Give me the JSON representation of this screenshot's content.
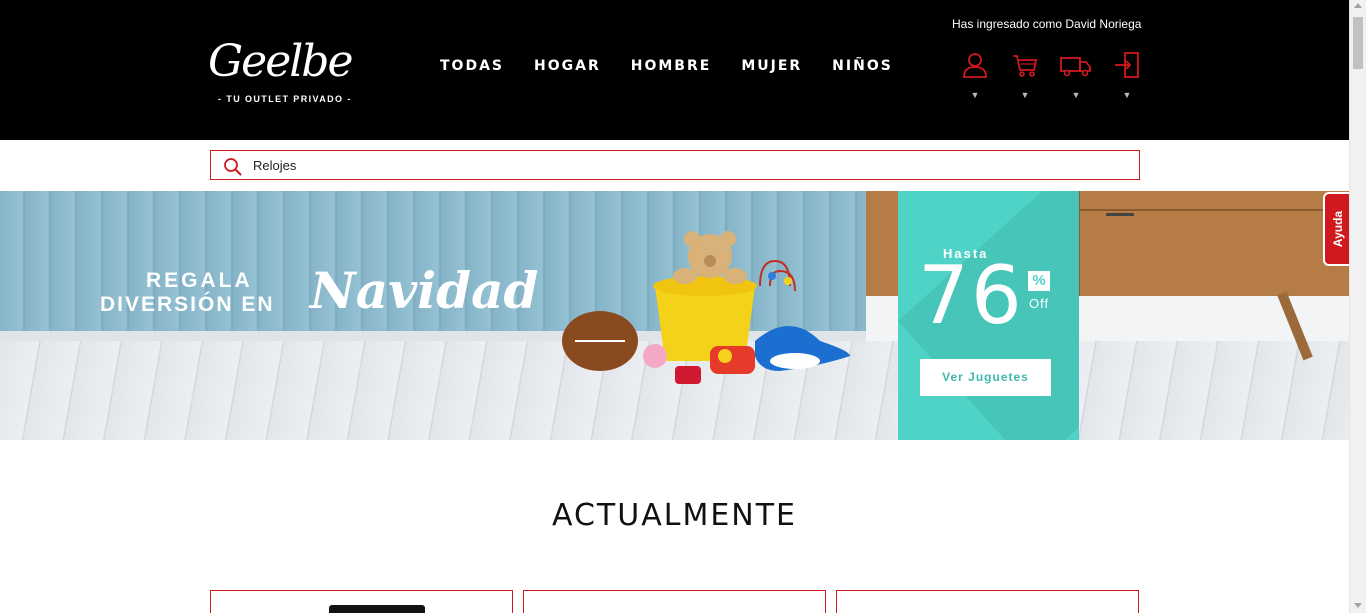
{
  "header": {
    "user_status": "Has ingresado como David Noriega",
    "logo_text": "Geelbe",
    "logo_tagline": "- TU OUTLET PRIVADO -",
    "nav": [
      {
        "label": "TODAS"
      },
      {
        "label": "HOGAR"
      },
      {
        "label": "HOMBRE"
      },
      {
        "label": "MUJER"
      },
      {
        "label": "NIÑOS"
      }
    ],
    "icons": [
      "user-icon",
      "cart-icon",
      "truck-icon",
      "logout-icon"
    ],
    "caret": "▼"
  },
  "search": {
    "value": "Relojes",
    "icon": "search-icon"
  },
  "banner": {
    "line1": "REGALA",
    "line2": "DIVERSIÓN EN",
    "script": "Navidad",
    "promo_prefix": "Hasta",
    "promo_number": "76",
    "promo_percent": "%",
    "promo_off": "Off",
    "cta": "Ver Juguetes"
  },
  "help": {
    "label": "Ayuda"
  },
  "section": {
    "title": "ACTUALMENTE"
  },
  "colors": {
    "brand_red": "#d0181f",
    "header_bg": "#000000",
    "promo_teal": "#50d3c7"
  }
}
